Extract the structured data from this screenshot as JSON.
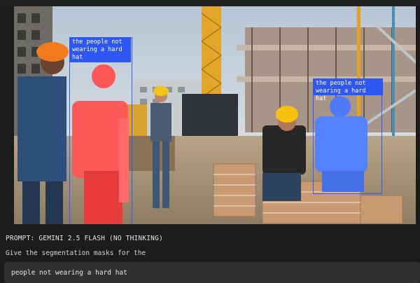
{
  "prompt": {
    "header": "PROMPT: GEMINI 2.5 FLASH (NO THINKING)",
    "instruction": "Give the segmentation masks for the",
    "query": "people not wearing a hard hat"
  },
  "detections": [
    {
      "label": "the people not\nwearing a hard\nhat",
      "color": "#2f5bff",
      "mask_color": "#ff4d4d"
    },
    {
      "label": "the people not\nwearing a hard hat",
      "color": "#2f5bff",
      "mask_color": "#4d7dff"
    }
  ],
  "colors": {
    "background": "#1b1b1b",
    "box": "#2f5bff",
    "label_bg": "#2d57f0",
    "mask_red": "#ff4d4d",
    "mask_blue": "#4d7dff"
  }
}
